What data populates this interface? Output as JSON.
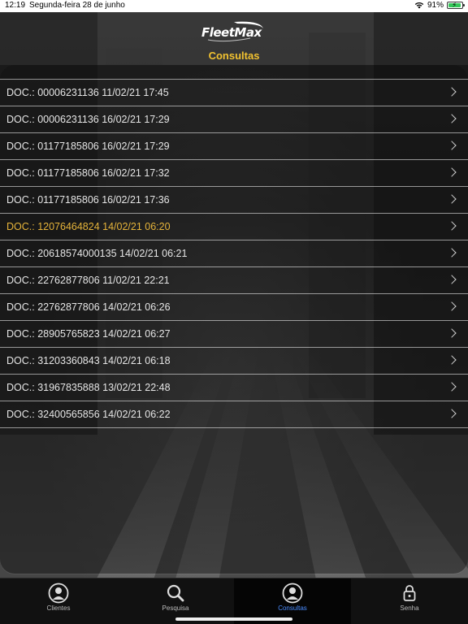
{
  "status_bar": {
    "time": "12:19",
    "date": "Segunda-feira 28 de junho",
    "battery": "91%",
    "battery_level": 0.91
  },
  "header": {
    "logo_text": "FleetMax",
    "title": "Consultas"
  },
  "colors": {
    "accent": "#f2c230",
    "highlight_row": "#e6b43a",
    "active_tab": "#4a8cff"
  },
  "consultas": [
    {
      "label": "DOC.: 00006231136 11/02/21 17:45",
      "highlight": false
    },
    {
      "label": "DOC.: 00006231136 16/02/21 17:29",
      "highlight": false
    },
    {
      "label": "DOC.: 01177185806 16/02/21 17:29",
      "highlight": false
    },
    {
      "label": "DOC.: 01177185806 16/02/21 17:32",
      "highlight": false
    },
    {
      "label": "DOC.: 01177185806 16/02/21 17:36",
      "highlight": false
    },
    {
      "label": "DOC.: 12076464824 14/02/21 06:20",
      "highlight": true
    },
    {
      "label": "DOC.: 20618574000135 14/02/21 06:21",
      "highlight": false
    },
    {
      "label": "DOC.: 22762877806 11/02/21 22:21",
      "highlight": false
    },
    {
      "label": "DOC.: 22762877806 14/02/21 06:26",
      "highlight": false
    },
    {
      "label": "DOC.: 28905765823 14/02/21 06:27",
      "highlight": false
    },
    {
      "label": "DOC.: 31203360843 14/02/21 06:18",
      "highlight": false
    },
    {
      "label": "DOC.: 31967835888 13/02/21 22:48",
      "highlight": false
    },
    {
      "label": "DOC.: 32400565856 14/02/21 06:22",
      "highlight": false
    }
  ],
  "tabs": [
    {
      "label": "Clientes",
      "icon": "person-circle-icon",
      "active": false
    },
    {
      "label": "Pesquisa",
      "icon": "search-icon",
      "active": false
    },
    {
      "label": "Consultas",
      "icon": "person-circle-icon",
      "active": true
    },
    {
      "label": "Senha",
      "icon": "lock-icon",
      "active": false
    }
  ]
}
